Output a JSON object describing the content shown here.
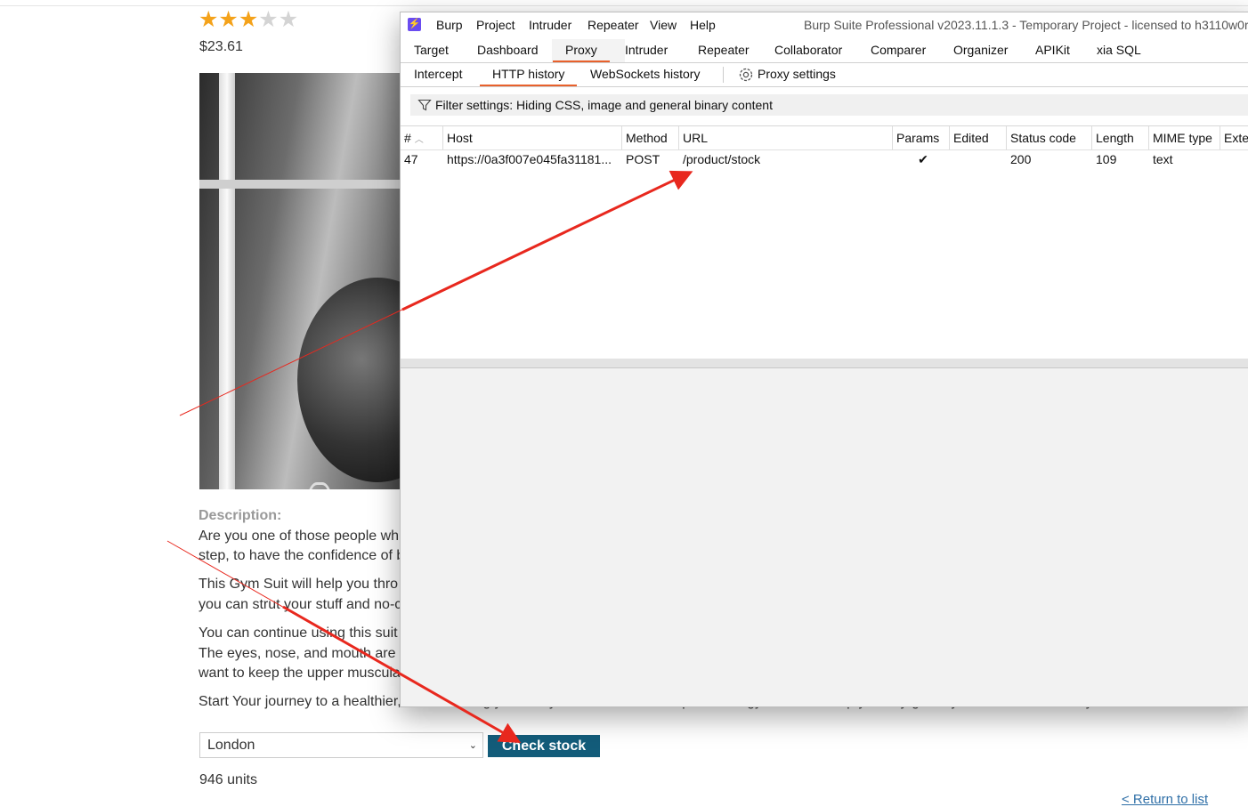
{
  "product": {
    "rating_stars_filled": 3,
    "rating_stars_total": 5,
    "price": "$23.61",
    "description_title": "Description:",
    "description_lines": [
      "Are you one of those people wh",
      "step, to have the confidence of b",
      "This Gym Suit will help you thro",
      "you can strut your stuff and no-c",
      "You can continue using this suit",
      "The eyes, nose, and mouth are",
      "want to keep the upper muscula",
      "Start Your journey to a healthier, better looking you today. For the advertised price, this gym suit will help you say goodbye to all those first day nerves."
    ],
    "location_select": "London",
    "check_stock_label": "Check stock",
    "stock_result": "946 units",
    "return_link": "< Return to list"
  },
  "burp": {
    "logo": "⚡",
    "menu": [
      "Burp",
      "Project",
      "Intruder",
      "Repeater",
      "View",
      "Help"
    ],
    "window_title": "Burp Suite Professional v2023.11.1.3 - Temporary Project - licensed to h3110w0r",
    "main_tabs": [
      "Target",
      "Dashboard",
      "Proxy",
      "Intruder",
      "Repeater",
      "Collaborator",
      "Comparer",
      "Organizer",
      "APIKit",
      "xia SQL"
    ],
    "main_tab_active": "Proxy",
    "proxy_tabs": [
      "Intercept",
      "HTTP history",
      "WebSockets history"
    ],
    "proxy_tab_active": "HTTP history",
    "proxy_settings_label": "Proxy settings",
    "filter_text": "Filter settings: Hiding CSS, image and general binary content",
    "table": {
      "columns": [
        "#",
        "Host",
        "Method",
        "URL",
        "Params",
        "Edited",
        "Status code",
        "Length",
        "MIME type",
        "Exten"
      ],
      "rows": [
        {
          "num": "47",
          "host": "https://0a3f007e045fa31181...",
          "method": "POST",
          "url": "/product/stock",
          "params": "✔",
          "edited": "",
          "status": "200",
          "length": "109",
          "mime": "text",
          "ext": ""
        }
      ]
    }
  },
  "colors": {
    "accent_tab": "#e8612c",
    "button_bg": "#135c7a",
    "star": "#f4a21a",
    "arrow": "#e8281e",
    "burp_logo": "#6a4cf0"
  }
}
